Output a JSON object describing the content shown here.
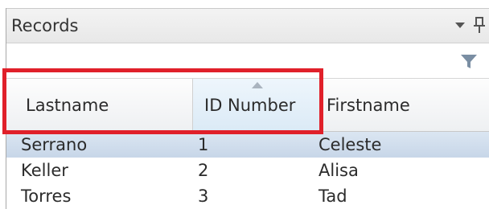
{
  "panel": {
    "title": "Records"
  },
  "filter": {
    "value": "",
    "placeholder": ""
  },
  "columns": [
    {
      "label": "Lastname"
    },
    {
      "label": "ID Number",
      "sorted": "ascending"
    },
    {
      "label": "Firstname"
    }
  ],
  "rows": [
    {
      "lastname": "Serrano",
      "id": "1",
      "firstname": "Celeste",
      "selected": true
    },
    {
      "lastname": "Keller",
      "id": "2",
      "firstname": "Alisa",
      "selected": false
    },
    {
      "lastname": "Torres",
      "id": "3",
      "firstname": "Tad",
      "selected": false
    }
  ],
  "icons": {
    "dropdown": "chevron-down-icon",
    "pin": "pin-icon",
    "filter": "funnel-icon",
    "sort": "sort-ascending-icon"
  },
  "colors": {
    "highlight": "#e0202a",
    "selected_row": "#cfdcec",
    "sorted_header": "#dbeaf6"
  }
}
